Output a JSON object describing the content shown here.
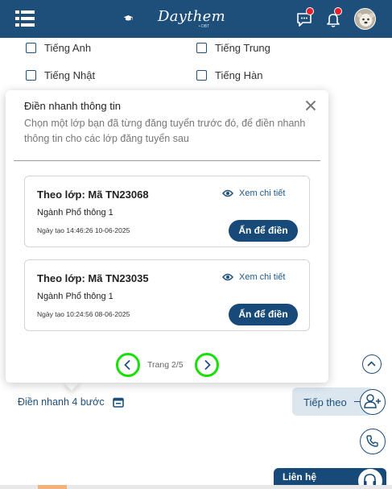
{
  "header": {
    "logo_text": "Daythem",
    "logo_sub": "• DBT",
    "icons": [
      "menu-icon",
      "chat-icon",
      "bell-icon",
      "avatar"
    ],
    "brand_color": "#1d4f7a"
  },
  "languages": {
    "items": [
      {
        "label": "Tiếng Anh"
      },
      {
        "label": "Tiếng Trung"
      },
      {
        "label": "Tiếng Nhật"
      },
      {
        "label": "Tiếng Hàn"
      }
    ]
  },
  "popup": {
    "title": "Điền nhanh thông tin",
    "description": "Chọn một lớp bạn đã từng đăng tuyển trước đó, để điền nhanh thông tin cho các lớp đăng tuyển sau",
    "cards": [
      {
        "title": "Theo lớp: Mã TN23068",
        "major": "Ngành Phổ thông 1",
        "date": "Ngày tạo 14:46:26 10-06-2025",
        "view_label": "Xem chi tiết",
        "fill_label": "Ấn để điền"
      },
      {
        "title": "Theo lớp: Mã TN23035",
        "major": "Ngành Phổ thông 1",
        "date": "Ngày tạo 10:24:56 08-06-2025",
        "view_label": "Xem chi tiết",
        "fill_label": "Ấn để điền"
      }
    ],
    "pager": {
      "label": "Trang 2/5",
      "highlight_color": "#18e000"
    }
  },
  "bottom": {
    "quick_fill_label": "Điền nhanh 4 bước",
    "next_label": "Tiếp theo",
    "contact_label": "Liên hệ"
  }
}
